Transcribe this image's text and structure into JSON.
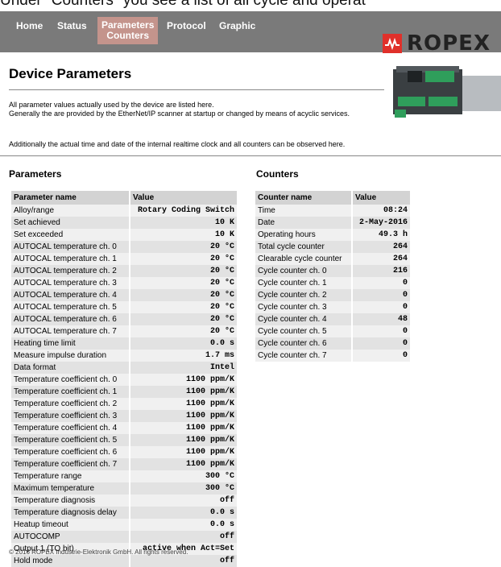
{
  "caption_top": "Under \"Counters\" you see a list of all cycle and operat",
  "nav": {
    "items": [
      {
        "label": "Home"
      },
      {
        "label": "Status"
      },
      {
        "label": "Parameters",
        "label2": "Counters"
      },
      {
        "label": "Protocol"
      },
      {
        "label": "Graphic"
      }
    ],
    "brand": "ROPEX",
    "brand_color": "#e0302a"
  },
  "page": {
    "title": "Device Parameters",
    "intro_line1": "All parameter values actually used by the device are listed here.",
    "intro_line2": "Generally the are provided by the EtherNet/IP scanner at startup or changed by means of acyclic services.",
    "intro_line3": "Additionally the actual time and date of the internal realtime clock and all counters can be observed here."
  },
  "parameters": {
    "heading": "Parameters",
    "col_name": "Parameter name",
    "col_value": "Value",
    "rows": [
      {
        "name": "Alloy/range",
        "value": "Rotary Coding Switch"
      },
      {
        "name": "Set achieved",
        "value": "10 K"
      },
      {
        "name": "Set exceeded",
        "value": "10 K"
      },
      {
        "name": "AUTOCAL temperature ch. 0",
        "value": "20 °C"
      },
      {
        "name": "AUTOCAL temperature ch. 1",
        "value": "20 °C"
      },
      {
        "name": "AUTOCAL temperature ch. 2",
        "value": "20 °C"
      },
      {
        "name": "AUTOCAL temperature ch. 3",
        "value": "20 °C"
      },
      {
        "name": "AUTOCAL temperature ch. 4",
        "value": "20 °C"
      },
      {
        "name": "AUTOCAL temperature ch. 5",
        "value": "20 °C"
      },
      {
        "name": "AUTOCAL temperature ch. 6",
        "value": "20 °C"
      },
      {
        "name": "AUTOCAL temperature ch. 7",
        "value": "20 °C"
      },
      {
        "name": "Heating time limit",
        "value": "0.0 s"
      },
      {
        "name": "Measure impulse duration",
        "value": "1.7 ms"
      },
      {
        "name": "Data format",
        "value": "Intel"
      },
      {
        "name": "Temperature coefficient ch. 0",
        "value": "1100 ppm/K"
      },
      {
        "name": "Temperature coefficient ch. 1",
        "value": "1100 ppm/K"
      },
      {
        "name": "Temperature coefficient ch. 2",
        "value": "1100 ppm/K"
      },
      {
        "name": "Temperature coefficient ch. 3",
        "value": "1100 ppm/K"
      },
      {
        "name": "Temperature coefficient ch. 4",
        "value": "1100 ppm/K"
      },
      {
        "name": "Temperature coefficient ch. 5",
        "value": "1100 ppm/K"
      },
      {
        "name": "Temperature coefficient ch. 6",
        "value": "1100 ppm/K"
      },
      {
        "name": "Temperature coefficient ch. 7",
        "value": "1100 ppm/K"
      },
      {
        "name": "Temperature range",
        "value": "300 °C"
      },
      {
        "name": "Maximum temperature",
        "value": "300 °C"
      },
      {
        "name": "Temperature diagnosis",
        "value": "off"
      },
      {
        "name": "Temperature diagnosis delay",
        "value": "0.0 s"
      },
      {
        "name": "Heatup timeout",
        "value": "0.0 s"
      },
      {
        "name": "AUTOCOMP",
        "value": "off"
      },
      {
        "name": "Output 1 (TO bit)",
        "value": "active when Act=Set"
      },
      {
        "name": "Hold mode",
        "value": "off"
      }
    ]
  },
  "counters": {
    "heading": "Counters",
    "col_name": "Counter name",
    "col_value": "Value",
    "rows": [
      {
        "name": "Time",
        "value": "08:24"
      },
      {
        "name": "Date",
        "value": "2-May-2016"
      },
      {
        "name": "Operating hours",
        "value": "49.3 h"
      },
      {
        "name": "Total cycle counter",
        "value": "264"
      },
      {
        "name": "Clearable cycle counter",
        "value": "264"
      },
      {
        "name": "Cycle counter ch. 0",
        "value": "216"
      },
      {
        "name": "Cycle counter ch. 1",
        "value": "0"
      },
      {
        "name": "Cycle counter ch. 2",
        "value": "0"
      },
      {
        "name": "Cycle counter ch. 3",
        "value": "0"
      },
      {
        "name": "Cycle counter ch. 4",
        "value": "48"
      },
      {
        "name": "Cycle counter ch. 5",
        "value": "0"
      },
      {
        "name": "Cycle counter ch. 6",
        "value": "0"
      },
      {
        "name": "Cycle counter ch. 7",
        "value": "0"
      }
    ]
  },
  "footer": "© 2016 ROPEX Industrie-Elektronik GmbH. All rights reserved."
}
